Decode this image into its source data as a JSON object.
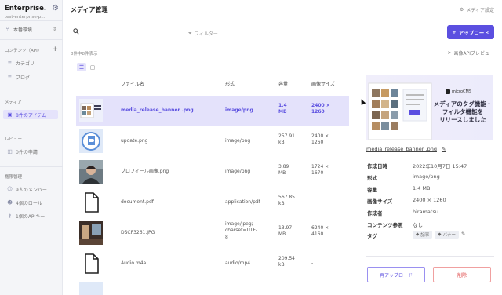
{
  "sidebar": {
    "workspace_name": "Enterprise...",
    "workspace_sub": "test-enterprise-p...",
    "environment": "本番環境",
    "sections": {
      "content": "コンテンツ（API）",
      "media": "メディア",
      "review": "レビュー",
      "permissions": "権限管理"
    },
    "content_items": [
      "カテゴリ",
      "ブログ"
    ],
    "media_item": "8件のアイテム",
    "review_item": "0件の申請",
    "permission_items": [
      "9人のメンバー",
      "4個のロール",
      "1個のAPIキー"
    ]
  },
  "header": {
    "title": "メディア管理",
    "settings_label": "メディア設定"
  },
  "toolbar": {
    "search_placeholder": "",
    "filter_label": "フィルター",
    "upload_label": "アップロード",
    "count_text": "8件中8件表示",
    "api_preview_label": "画像APIプレビュー"
  },
  "table": {
    "headers": {
      "filename": "ファイル名",
      "format": "形式",
      "size": "容量",
      "dimensions": "画像サイズ"
    },
    "rows": [
      {
        "filename": "media_release_banner .png",
        "format": "image/png",
        "size": "1.4\nMB",
        "dimensions": "2400 ×\n1260"
      },
      {
        "filename": "update.png",
        "format": "image/png",
        "size": "257.91\nkB",
        "dimensions": "2400 ×\n1260"
      },
      {
        "filename": "プロフィール画像.png",
        "format": "image/png",
        "size": "3.89\nMB",
        "dimensions": "1724 ×\n1670"
      },
      {
        "filename": "document.pdf",
        "format": "application/pdf",
        "size": "567.85\nkB",
        "dimensions": "-"
      },
      {
        "filename": "DSCF3261.JPG",
        "format": "image/jpeg;\ncharset=UTF-\n8",
        "size": "13.97\nMB",
        "dimensions": "6240 ×\n4160"
      },
      {
        "filename": "Audio.m4a",
        "format": "audio/mp4",
        "size": "209.54\nkB",
        "dimensions": "-"
      }
    ]
  },
  "detail": {
    "banner_logo": "microCMS",
    "banner_title": "メディアのタグ機能・\nフィルタ機能を\nリリースしました",
    "filename": "media_release_banner .png",
    "meta": [
      {
        "key": "作成日時",
        "value": "2022年10月7日 15:47"
      },
      {
        "key": "形式",
        "value": "image/png"
      },
      {
        "key": "容量",
        "value": "1.4 MB"
      },
      {
        "key": "画像サイズ",
        "value": "2400 × 1260"
      },
      {
        "key": "作成者",
        "value": "hiramatsu"
      },
      {
        "key": "コンテンツ参照",
        "value": "なし"
      }
    ],
    "tags_label": "タグ",
    "tags": [
      "記事",
      "バナー"
    ],
    "reupload_label": "再アップロード",
    "delete_label": "削除"
  }
}
